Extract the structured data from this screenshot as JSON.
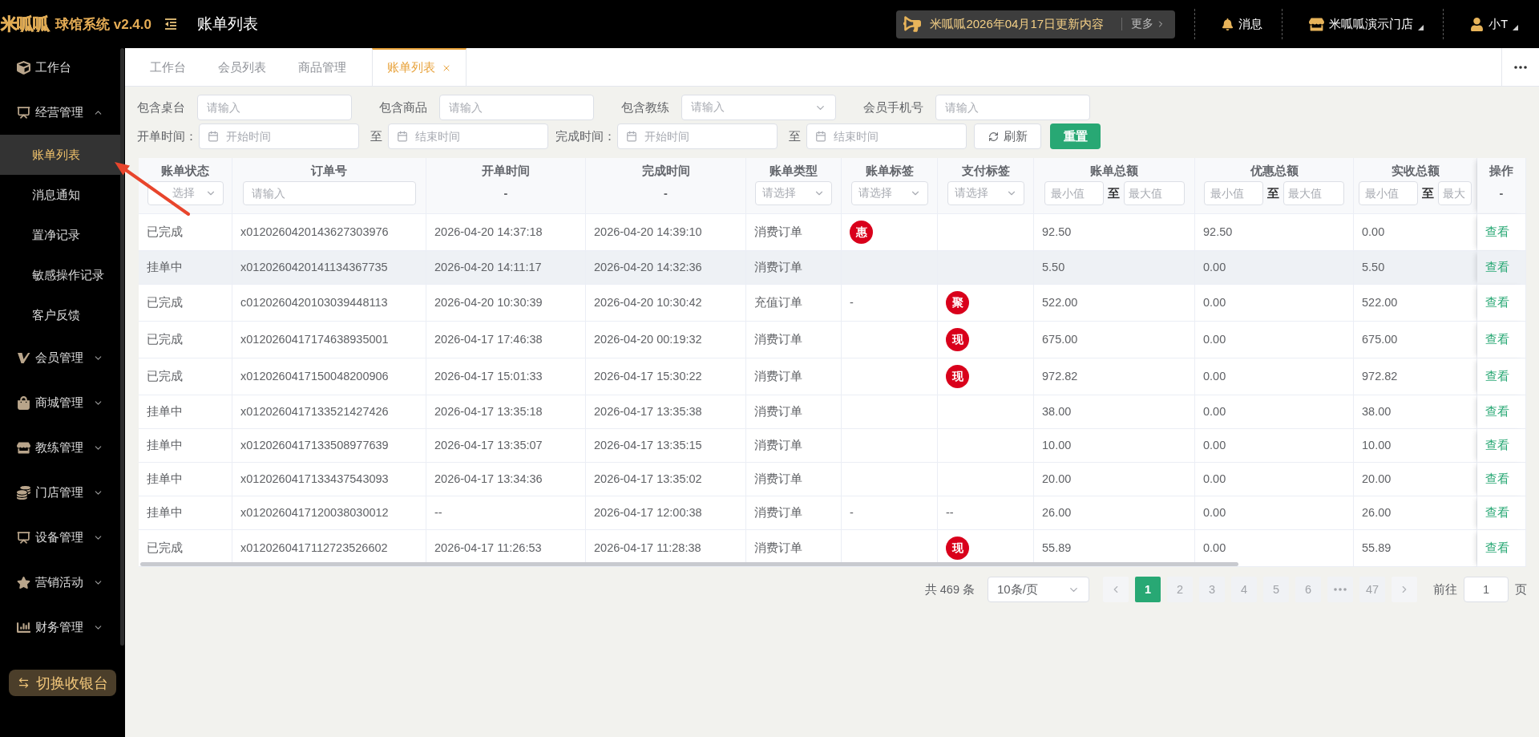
{
  "header": {
    "logo": "米呱呱",
    "app_name": "球馆系统 v2.4.0",
    "page_title": "账单列表",
    "notice": {
      "text": "米呱呱2026年04月17日更新内容",
      "more": "更多"
    },
    "actions": [
      {
        "kind": "messages",
        "label": "消息"
      },
      {
        "kind": "store",
        "label": "米呱呱演示门店"
      },
      {
        "kind": "user",
        "label": "小T"
      }
    ]
  },
  "sidebar": {
    "items": [
      {
        "kind": "link",
        "label": "工作台"
      },
      {
        "kind": "group",
        "label": "经营管理",
        "expanded": true,
        "children": [
          {
            "label": "账单列表",
            "selected": true
          },
          {
            "label": "消息通知",
            "selected": false
          },
          {
            "label": "置净记录",
            "selected": false
          },
          {
            "label": "敏感操作记录",
            "selected": false
          },
          {
            "label": "客户反馈",
            "selected": false
          }
        ]
      },
      {
        "kind": "group",
        "label": "会员管理",
        "expanded": false
      },
      {
        "kind": "group",
        "label": "商城管理",
        "expanded": false
      },
      {
        "kind": "group",
        "label": "教练管理",
        "expanded": false
      },
      {
        "kind": "group",
        "label": "门店管理",
        "expanded": false
      },
      {
        "kind": "group",
        "label": "设备管理",
        "expanded": false
      },
      {
        "kind": "group",
        "label": "营销活动",
        "expanded": false
      },
      {
        "kind": "group",
        "label": "财务管理",
        "expanded": false
      }
    ],
    "switch_button": "切换收银台"
  },
  "tabs": [
    {
      "label": "工作台",
      "selected": false,
      "closable": false
    },
    {
      "label": "会员列表",
      "selected": false,
      "closable": false
    },
    {
      "label": "商品管理",
      "selected": false,
      "closable": false
    },
    {
      "label": "账单列表",
      "selected": true,
      "closable": true
    }
  ],
  "filters": {
    "rows": [
      {
        "fields": [
          {
            "kind": "input",
            "label": "包含桌台",
            "placeholder": "请输入"
          },
          {
            "kind": "input",
            "label": "包含商品",
            "placeholder": "请输入"
          },
          {
            "kind": "select",
            "label": "包含教练",
            "placeholder": "请输入"
          },
          {
            "kind": "input",
            "label": "会员手机号",
            "placeholder": "请输入"
          }
        ]
      },
      {
        "fields": [
          {
            "kind": "date_range",
            "label": "开单时间：",
            "start_placeholder": "开始时间",
            "separator": "至",
            "end_placeholder": "结束时间"
          },
          {
            "kind": "date_range",
            "label": "完成时间：",
            "start_placeholder": "开始时间",
            "separator": "至",
            "end_placeholder": "结束时间"
          },
          {
            "kind": "refresh_button",
            "label": "刷新"
          },
          {
            "kind": "primary_button",
            "label": "重置"
          }
        ]
      }
    ]
  },
  "table": {
    "columns": [
      {
        "title": "账单状态",
        "filter": {
          "kind": "select",
          "placeholder": "选择"
        }
      },
      {
        "title": "订单号",
        "filter": {
          "kind": "input",
          "placeholder": "请输入"
        }
      },
      {
        "title": "开单时间",
        "filter": {
          "kind": "text",
          "text": "-"
        }
      },
      {
        "title": "完成时间",
        "filter": {
          "kind": "text",
          "text": "-"
        }
      },
      {
        "title": "账单类型",
        "filter": {
          "kind": "select",
          "placeholder": "请选择"
        }
      },
      {
        "title": "账单标签",
        "filter": {
          "kind": "select",
          "placeholder": "请选择"
        }
      },
      {
        "title": "支付标签",
        "filter": {
          "kind": "select",
          "placeholder": "请选择"
        }
      },
      {
        "title": "账单总额",
        "filter": {
          "kind": "range",
          "min_placeholder": "最小值",
          "separator": "至",
          "max_placeholder": "最大值"
        }
      },
      {
        "title": "优惠总额",
        "filter": {
          "kind": "range",
          "min_placeholder": "最小值",
          "separator": "至",
          "max_placeholder": "最大值"
        }
      },
      {
        "title": "实收总额",
        "filter": {
          "kind": "range",
          "min_placeholder": "最小值",
          "separator": "至",
          "max_placeholder": "最大"
        }
      },
      {
        "title": "操作",
        "filter": {
          "kind": "text",
          "text": "-"
        }
      }
    ],
    "rows": [
      {
        "hovered": false,
        "status": "已完成",
        "order_no": "x0120260420143627303976",
        "open_time": "2026-04-20 14:37:18",
        "finish_time": "2026-04-20 14:39:10",
        "type": "消费订单",
        "bill_tag": {
          "kind": "badge",
          "text": "惠"
        },
        "total": "92.50",
        "discount": "92.50",
        "received": "0.00",
        "action": "查看"
      },
      {
        "hovered": true,
        "status": "挂单中",
        "order_no": "x0120260420141134367735",
        "open_time": "2026-04-20 14:11:17",
        "finish_time": "2026-04-20 14:32:36",
        "type": "消费订单",
        "total": "5.50",
        "discount": "0.00",
        "received": "5.50",
        "action": "查看"
      },
      {
        "hovered": false,
        "status": "已完成",
        "order_no": "c0120260420103039448113",
        "open_time": "2026-04-20 10:30:39",
        "finish_time": "2026-04-20 10:30:42",
        "type": "充值订单",
        "bill_tag": {
          "kind": "text",
          "text": "-"
        },
        "pay_tag": {
          "kind": "badge",
          "text": "聚"
        },
        "total": "522.00",
        "discount": "0.00",
        "received": "522.00",
        "action": "查看"
      },
      {
        "hovered": false,
        "status": "已完成",
        "order_no": "x0120260417174638935001",
        "open_time": "2026-04-17 17:46:38",
        "finish_time": "2026-04-20 00:19:32",
        "type": "消费订单",
        "pay_tag": {
          "kind": "badge",
          "text": "现"
        },
        "total": "675.00",
        "discount": "0.00",
        "received": "675.00",
        "action": "查看"
      },
      {
        "hovered": false,
        "status": "已完成",
        "order_no": "x0120260417150048200906",
        "open_time": "2026-04-17 15:01:33",
        "finish_time": "2026-04-17 15:30:22",
        "type": "消费订单",
        "pay_tag": {
          "kind": "badge",
          "text": "现"
        },
        "total": "972.82",
        "discount": "0.00",
        "received": "972.82",
        "action": "查看"
      },
      {
        "hovered": false,
        "status": "挂单中",
        "order_no": "x0120260417133521427426",
        "open_time": "2026-04-17 13:35:18",
        "finish_time": "2026-04-17 13:35:38",
        "type": "消费订单",
        "total": "38.00",
        "discount": "0.00",
        "received": "38.00",
        "action": "查看"
      },
      {
        "hovered": false,
        "status": "挂单中",
        "order_no": "x0120260417133508977639",
        "open_time": "2026-04-17 13:35:07",
        "finish_time": "2026-04-17 13:35:15",
        "type": "消费订单",
        "total": "10.00",
        "discount": "0.00",
        "received": "10.00",
        "action": "查看"
      },
      {
        "hovered": false,
        "status": "挂单中",
        "order_no": "x0120260417133437543093",
        "open_time": "2026-04-17 13:34:36",
        "finish_time": "2026-04-17 13:35:02",
        "type": "消费订单",
        "total": "20.00",
        "discount": "0.00",
        "received": "20.00",
        "action": "查看"
      },
      {
        "hovered": false,
        "status": "挂单中",
        "order_no": "x0120260417120038030012",
        "open_time": "--",
        "finish_time": "2026-04-17 12:00:38",
        "type": "消费订单",
        "bill_tag": {
          "kind": "text",
          "text": "-"
        },
        "pay_tag": {
          "kind": "text",
          "text": "--"
        },
        "total": "26.00",
        "discount": "0.00",
        "received": "26.00",
        "action": "查看"
      },
      {
        "hovered": false,
        "status": "已完成",
        "order_no": "x0120260417112723526602",
        "open_time": "2026-04-17 11:26:53",
        "finish_time": "2026-04-17 11:28:38",
        "type": "消费订单",
        "pay_tag": {
          "kind": "badge",
          "text": "现"
        },
        "total": "55.89",
        "discount": "0.00",
        "received": "55.89",
        "action": "查看"
      }
    ]
  },
  "pagination": {
    "total": "共 469 条",
    "page_size": "10条/页",
    "pages": [
      {
        "kind": "page",
        "label": "1",
        "selected": true
      },
      {
        "kind": "page",
        "label": "2",
        "selected": false
      },
      {
        "kind": "page",
        "label": "3",
        "selected": false
      },
      {
        "kind": "page",
        "label": "4",
        "selected": false
      },
      {
        "kind": "page",
        "label": "5",
        "selected": false
      },
      {
        "kind": "page",
        "label": "6",
        "selected": false
      },
      {
        "kind": "more",
        "selected": false
      },
      {
        "kind": "page",
        "label": "47",
        "selected": false
      }
    ],
    "goto_label": "前往",
    "goto_value": "1",
    "goto_unit": "页"
  }
}
